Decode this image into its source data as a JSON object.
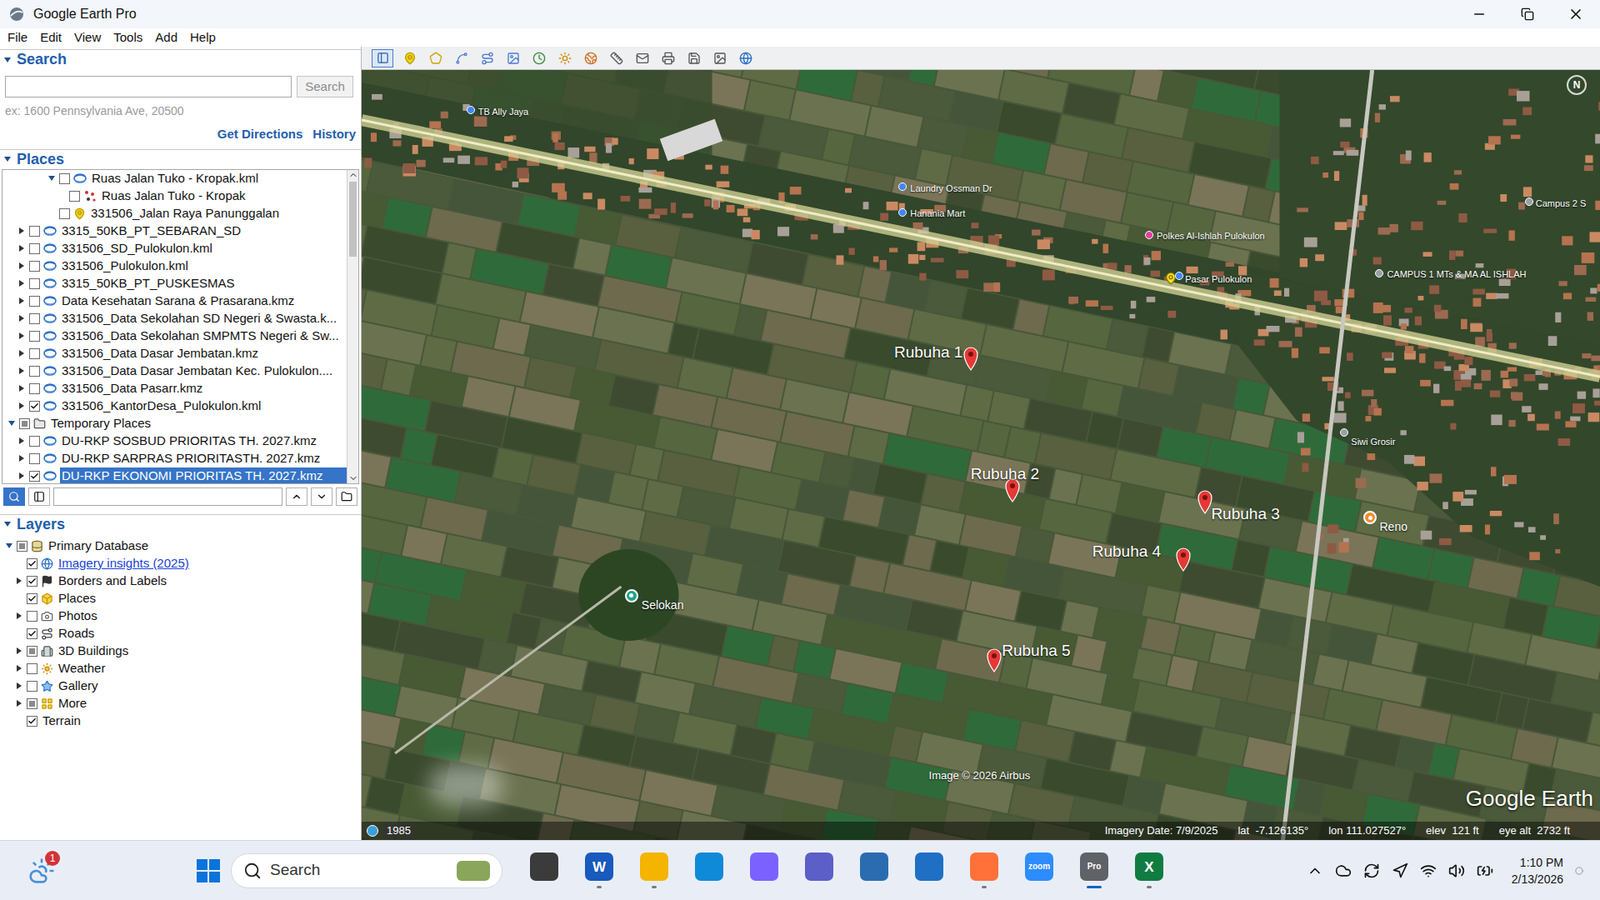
{
  "window": {
    "title": "Google Earth Pro"
  },
  "menu": [
    "File",
    "Edit",
    "View",
    "Tools",
    "Add",
    "Help"
  ],
  "search": {
    "heading": "Search",
    "expanded": true,
    "value": "",
    "button": {
      "label": "Search",
      "disabled": true
    },
    "hint": "ex: 1600 Pennsylvania Ave, 20500",
    "links": [
      "Get Directions",
      "History"
    ]
  },
  "places": {
    "heading": "Places",
    "expanded": true,
    "filter": "",
    "items": [
      {
        "label": "Ruas Jalan Tuko - Kropak.kml",
        "depth": 4,
        "expandable": true,
        "expanded": true,
        "checked": false,
        "mixed": false,
        "kind": "file",
        "selected": false
      },
      {
        "label": "Ruas Jalan Tuko - Kropak",
        "depth": 5,
        "expandable": false,
        "expanded": false,
        "checked": false,
        "mixed": false,
        "kind": "path",
        "selected": false
      },
      {
        "label": "331506_Jalan Raya Panunggalan",
        "depth": 4,
        "expandable": false,
        "expanded": false,
        "checked": false,
        "mixed": false,
        "kind": "placemark",
        "selected": false
      },
      {
        "label": "3315_50KB_PT_SEBARAN_SD",
        "depth": 1,
        "expandable": true,
        "expanded": false,
        "checked": false,
        "mixed": false,
        "kind": "file",
        "selected": false
      },
      {
        "label": "331506_SD_Pulokulon.kml",
        "depth": 1,
        "expandable": true,
        "expanded": false,
        "checked": false,
        "mixed": false,
        "kind": "file",
        "selected": false
      },
      {
        "label": "331506_Pulokulon.kml",
        "depth": 1,
        "expandable": true,
        "expanded": false,
        "checked": false,
        "mixed": false,
        "kind": "file",
        "selected": false
      },
      {
        "label": "3315_50KB_PT_PUSKESMAS",
        "depth": 1,
        "expandable": true,
        "expanded": false,
        "checked": false,
        "mixed": false,
        "kind": "file",
        "selected": false
      },
      {
        "label": "Data Kesehatan Sarana & Prasarana.kmz",
        "depth": 1,
        "expandable": true,
        "expanded": false,
        "checked": false,
        "mixed": false,
        "kind": "file",
        "selected": false
      },
      {
        "label": "331506_Data Sekolahan SD Negeri & Swasta.k...",
        "depth": 1,
        "expandable": true,
        "expanded": false,
        "checked": false,
        "mixed": false,
        "kind": "file",
        "selected": false
      },
      {
        "label": "331506_Data Sekolahan SMPMTS Negeri & Sw...",
        "depth": 1,
        "expandable": true,
        "expanded": false,
        "checked": false,
        "mixed": false,
        "kind": "file",
        "selected": false
      },
      {
        "label": "331506_Data Dasar Jembatan.kmz",
        "depth": 1,
        "expandable": true,
        "expanded": false,
        "checked": false,
        "mixed": false,
        "kind": "file",
        "selected": false
      },
      {
        "label": "331506_Data Dasar Jembatan Kec. Pulokulon....",
        "depth": 1,
        "expandable": true,
        "expanded": false,
        "checked": false,
        "mixed": false,
        "kind": "file",
        "selected": false
      },
      {
        "label": "331506_Data Pasarr.kmz",
        "depth": 1,
        "expandable": true,
        "expanded": false,
        "checked": false,
        "mixed": false,
        "kind": "file",
        "selected": false
      },
      {
        "label": "331506_KantorDesa_Pulokulon.kml",
        "depth": 1,
        "expandable": true,
        "expanded": false,
        "checked": true,
        "mixed": false,
        "kind": "file",
        "selected": false
      },
      {
        "label": "Temporary Places",
        "depth": 0,
        "expandable": true,
        "expanded": true,
        "checked": false,
        "mixed": true,
        "kind": "folder",
        "selected": false
      },
      {
        "label": "DU-RKP SOSBUD PRIORITAS TH. 2027.kmz",
        "depth": 1,
        "expandable": true,
        "expanded": false,
        "checked": false,
        "mixed": false,
        "kind": "file",
        "selected": false
      },
      {
        "label": "DU-RKP SARPRAS PRIORITASTH. 2027.kmz",
        "depth": 1,
        "expandable": true,
        "expanded": false,
        "checked": false,
        "mixed": false,
        "kind": "file",
        "selected": false
      },
      {
        "label": "DU-RKP EKONOMI PRIORITAS TH. 2027.kmz",
        "depth": 1,
        "expandable": true,
        "expanded": false,
        "checked": true,
        "mixed": false,
        "kind": "file",
        "selected": true
      }
    ]
  },
  "layers": {
    "heading": "Layers",
    "expanded": true,
    "items": [
      {
        "label": "Primary Database",
        "depth": 0,
        "expandable": true,
        "expanded": true,
        "checked": false,
        "mixed": true,
        "kind": "database",
        "link": false
      },
      {
        "label": "Imagery insights (2025)",
        "depth": 1,
        "expandable": false,
        "expanded": false,
        "checked": true,
        "mixed": false,
        "kind": "imagery",
        "link": true
      },
      {
        "label": "Borders and Labels",
        "depth": 1,
        "expandable": true,
        "expanded": false,
        "checked": true,
        "mixed": false,
        "kind": "borders",
        "link": false
      },
      {
        "label": "Places",
        "depth": 1,
        "expandable": false,
        "expanded": false,
        "checked": true,
        "mixed": false,
        "kind": "places",
        "link": false
      },
      {
        "label": "Photos",
        "depth": 1,
        "expandable": true,
        "expanded": false,
        "checked": false,
        "mixed": false,
        "kind": "photos",
        "link": false
      },
      {
        "label": "Roads",
        "depth": 1,
        "expandable": false,
        "expanded": false,
        "checked": true,
        "mixed": false,
        "kind": "roads",
        "link": false
      },
      {
        "label": "3D Buildings",
        "depth": 1,
        "expandable": true,
        "expanded": false,
        "checked": false,
        "mixed": true,
        "kind": "buildings",
        "link": false
      },
      {
        "label": "Weather",
        "depth": 1,
        "expandable": true,
        "expanded": false,
        "checked": false,
        "mixed": false,
        "kind": "weather",
        "link": false
      },
      {
        "label": "Gallery",
        "depth": 1,
        "expandable": true,
        "expanded": false,
        "checked": false,
        "mixed": false,
        "kind": "gallery",
        "link": false
      },
      {
        "label": "More",
        "depth": 1,
        "expandable": true,
        "expanded": false,
        "checked": false,
        "mixed": true,
        "kind": "more",
        "link": false
      },
      {
        "label": "Terrain",
        "depth": 1,
        "expandable": false,
        "expanded": false,
        "checked": true,
        "mixed": false,
        "kind": "none",
        "link": false
      }
    ]
  },
  "map": {
    "markers": [
      {
        "label": "Rubuha 1",
        "kind": "balloon",
        "color": "#e53935"
      },
      {
        "label": "Rubuha 2",
        "kind": "balloon",
        "color": "#e53935"
      },
      {
        "label": "Rubuha 3",
        "kind": "balloon",
        "color": "#e53935"
      },
      {
        "label": "Rubuha 4",
        "kind": "balloon",
        "color": "#e53935"
      },
      {
        "label": "Rubuha 5",
        "kind": "balloon",
        "color": "#e53935"
      },
      {
        "label": "Selokan",
        "kind": "circle",
        "color": "#1fa58a"
      },
      {
        "label": "Reno",
        "kind": "circle",
        "color": "#f08c2e"
      },
      {
        "label": "Siwi Grosir",
        "kind": "poi",
        "color": "#9aa0a6"
      },
      {
        "label": "CAMPUS 1 MTs & MA AL ISHLAH",
        "kind": "poi",
        "color": "#9aa0a6"
      },
      {
        "label": "Pasar Pulokulon",
        "kind": "poi",
        "color": "#4285f4"
      },
      {
        "label": "Polkes Al-Ishlah Pulokulon",
        "kind": "poi",
        "color": "#e040a0"
      },
      {
        "label": "Hanania Mart",
        "kind": "poi",
        "color": "#4285f4"
      },
      {
        "label": "Laundry Ossman Dr",
        "kind": "poi",
        "color": "#4285f4"
      },
      {
        "label": "TB Ally Jaya",
        "kind": "poi",
        "color": "#4285f4"
      },
      {
        "label": "Campus 2 S",
        "kind": "poi",
        "color": "#9aa0a6"
      }
    ],
    "compass": "N",
    "attribution": "Image © 2026 Airbus",
    "logo": "Google Earth",
    "history_year": "1985",
    "status": [
      "Imagery Date: 7/9/2025",
      "lat  -7.126135°",
      "lon 111.027527°",
      "elev  121 ft",
      "eye alt  2732 ft"
    ]
  },
  "taskbar": {
    "weather_badge": "1",
    "search": "Search",
    "apps": [
      {
        "color": "#3b3b3b",
        "running": false,
        "active": false
      },
      {
        "glyph": "W",
        "color": "#185abd",
        "running": true,
        "active": false
      },
      {
        "color": "#f4b400",
        "running": true,
        "active": false
      },
      {
        "color": "#0f8ad8",
        "running": false,
        "active": false
      },
      {
        "color": "#7b61ff",
        "running": false,
        "active": false
      },
      {
        "color": "#5b5fc7",
        "running": false,
        "active": false
      },
      {
        "color": "#2b6cb0",
        "running": false,
        "active": false
      },
      {
        "color": "#1f6fc5",
        "running": false,
        "active": false
      },
      {
        "color": "#ff7139",
        "running": true,
        "active": false
      },
      {
        "glyph": "zoom",
        "color": "#2d8cff",
        "running": false,
        "active": false
      },
      {
        "glyph": "Pro",
        "color": "#5f6368",
        "running": true,
        "active": true
      },
      {
        "glyph": "X",
        "color": "#107c41",
        "running": true,
        "active": false
      }
    ],
    "time": "1:10 PM",
    "date": "2/13/2026"
  }
}
